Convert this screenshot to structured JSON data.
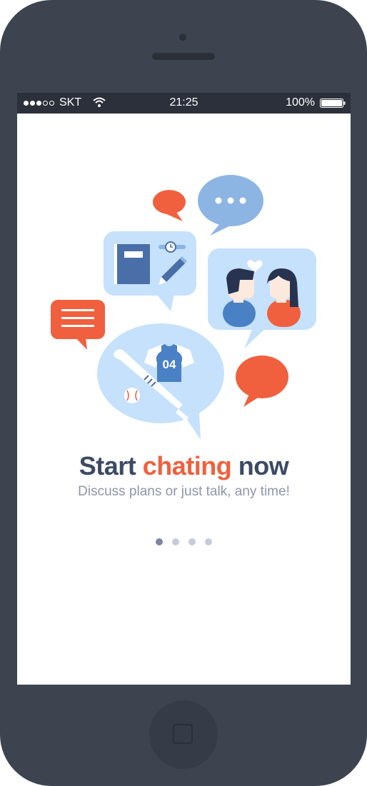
{
  "status_bar": {
    "signal_dots": 5,
    "signal_filled": 3,
    "carrier": "SKT",
    "time": "21:25",
    "battery": "100%"
  },
  "illustration": {
    "jersey_number": "04",
    "icons": [
      "chat-bubble-icon",
      "ellipsis-bubble-icon",
      "notebook-icon",
      "pencil-icon",
      "couple-icon",
      "heart-icon",
      "message-lines-icon",
      "baseball-bat-icon",
      "baseball-icon",
      "jersey-icon"
    ]
  },
  "onboarding": {
    "headline_start": "Start ",
    "headline_accent": "chating",
    "headline_end": " now",
    "subtitle": "Discuss plans or just talk, any time!",
    "page_count": 4,
    "active_page": 1
  },
  "colors": {
    "frame": "#3d4450",
    "accent": "#f0603e",
    "bubble_light": "#c6e1fb",
    "bubble_blue": "#8cb5e3",
    "headline": "#3d4a63"
  }
}
